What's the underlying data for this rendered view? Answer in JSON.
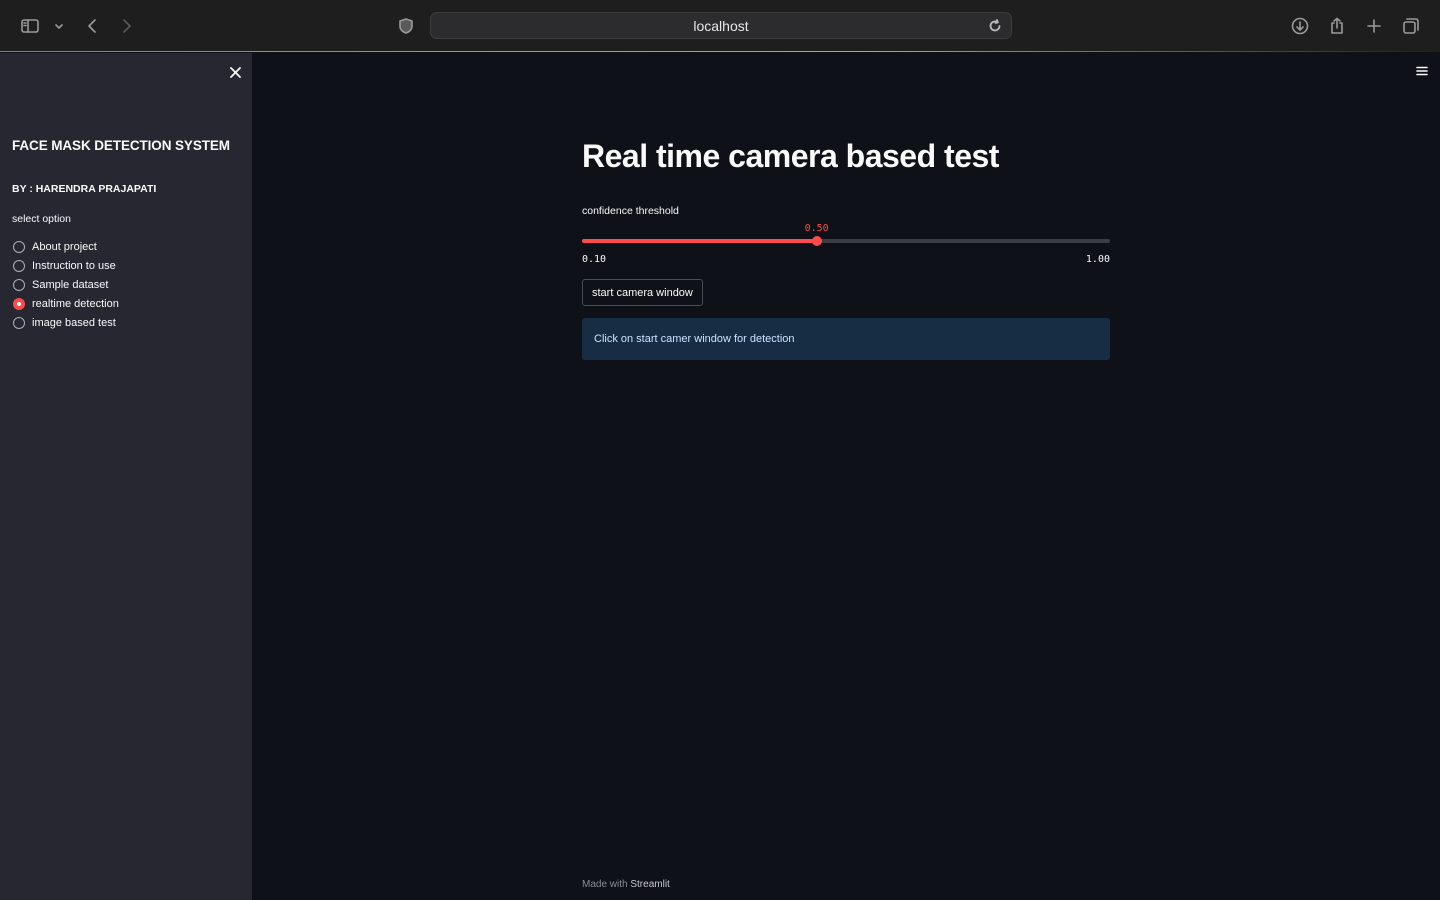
{
  "browser": {
    "url": "localhost"
  },
  "sidebar": {
    "title": "FACE MASK DETECTION SYSTEM",
    "author": "BY : HARENDRA PRAJAPATI",
    "select_label": "select option",
    "options": [
      {
        "label": "About project",
        "selected": false
      },
      {
        "label": "Instruction to use",
        "selected": false
      },
      {
        "label": "Sample dataset",
        "selected": false
      },
      {
        "label": "realtime detection",
        "selected": true
      },
      {
        "label": "image based test",
        "selected": false
      }
    ]
  },
  "main": {
    "title": "Real time camera based test",
    "slider": {
      "label": "confidence threshold",
      "value": "0.50",
      "min": "0.10",
      "max": "1.00",
      "accent": "#ff4b4b"
    },
    "button_label": "start camera window",
    "info_text": "Click on start camer window for detection"
  },
  "footer": {
    "prefix": "Made with",
    "brand": "Streamlit"
  }
}
